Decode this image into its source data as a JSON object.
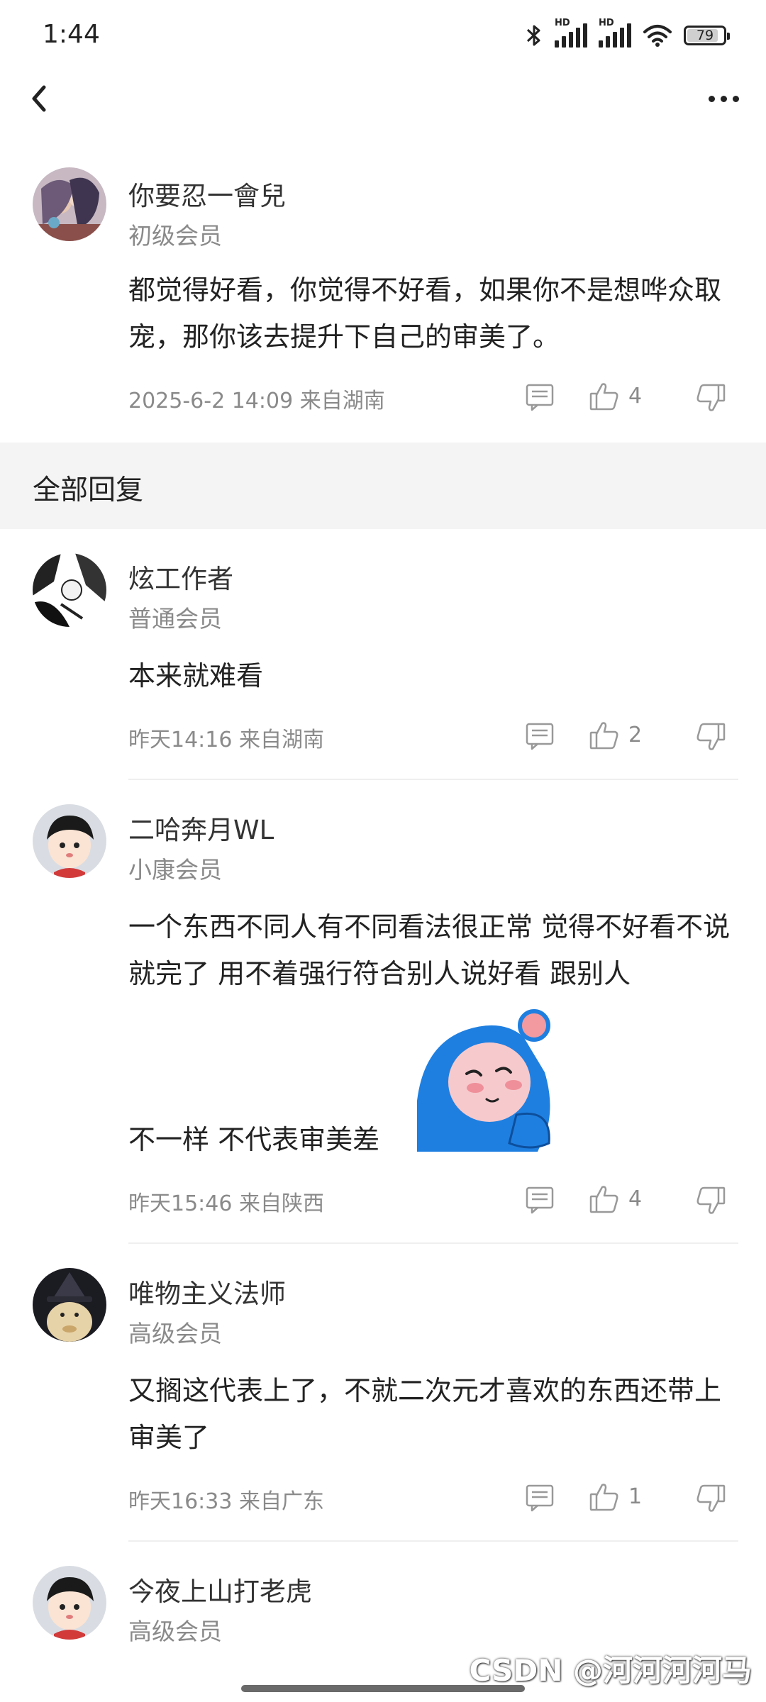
{
  "status_bar": {
    "time": "1:44",
    "hd1": "HD",
    "hd2": "HD",
    "battery": "79"
  },
  "nav": {
    "back_icon": "chevron-left-icon",
    "more_icon": "more-horizontal-icon"
  },
  "main_comment": {
    "username": "你要忍一會兒",
    "level": "初级会员",
    "text": "都觉得好看，你觉得不好看，如果你不是想哗众取宠，那你该去提升下自己的审美了。",
    "meta": "2025-6-2 14:09  来自湖南",
    "likes": "4"
  },
  "section": {
    "title": "全部回复"
  },
  "replies": [
    {
      "username": "炫工作者",
      "level": "普通会员",
      "text": "本来就难看",
      "meta": "昨天14:16 来自湖南",
      "likes": "2"
    },
    {
      "username": "二哈奔月WL",
      "level": "小康会员",
      "text": "一个东西不同人有不同看法很正常  觉得不好看不说就完了 用不着强行符合别人说好看  跟别人",
      "text_tail": "不一样 不代表审美差",
      "meta": "昨天15:46 来自陕西",
      "likes": "4"
    },
    {
      "username": "唯物主义法师",
      "level": "高级会员",
      "text": "又搁这代表上了，不就二次元才喜欢的东西还带上审美了",
      "meta": "昨天16:33 来自广东",
      "likes": "1"
    },
    {
      "username": "今夜上山打老虎",
      "level": "高级会员"
    }
  ],
  "watermark": "CSDN @河河河河马",
  "colors": {
    "background": "#ffffff",
    "section_bg": "#f4f4f4",
    "secondary_text": "#8a8a8a",
    "sticker_blue": "#1f7fe0"
  }
}
